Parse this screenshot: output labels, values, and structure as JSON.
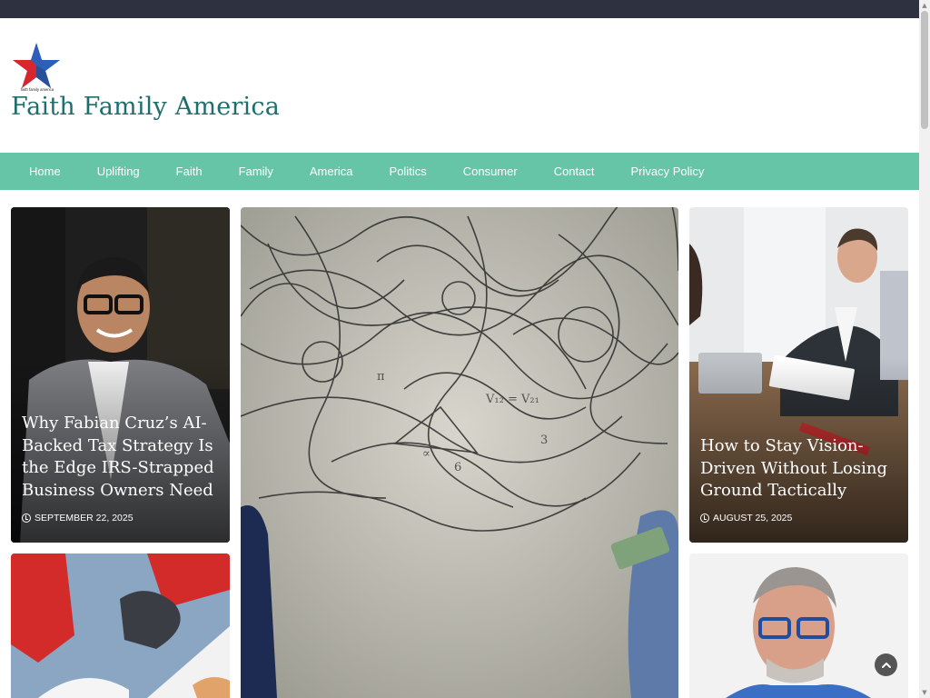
{
  "site": {
    "title": "Faith Family America",
    "logo_text": "faith family america",
    "colors": {
      "topbar": "#2e3240",
      "nav": "#66c5a6",
      "title": "#1e6e6e"
    }
  },
  "nav": {
    "items": [
      {
        "label": "Home"
      },
      {
        "label": "Uplifting"
      },
      {
        "label": "Faith"
      },
      {
        "label": "Family"
      },
      {
        "label": "America"
      },
      {
        "label": "Politics"
      },
      {
        "label": "Consumer"
      },
      {
        "label": "Contact"
      },
      {
        "label": "Privacy Policy"
      }
    ]
  },
  "posts": [
    {
      "title": "Why Fabian Cruz’s AI-Backed Tax Strategy Is the Edge IRS-Strapped Business Owners Need",
      "date": "SEPTEMBER 22, 2025",
      "image": "man-in-suit-glasses-photo"
    },
    {
      "title": "",
      "date": "",
      "image": "scribbled-equations-wall-photo"
    },
    {
      "title": "How to Stay Vision-Driven Without Losing Ground Tactically",
      "date": "AUGUST 25, 2025",
      "image": "business-meeting-photo"
    },
    {
      "title": "",
      "date": "",
      "image": "red-sneakers-papers-photo"
    },
    {
      "title": "",
      "date": "",
      "image": "man-blue-glasses-portrait-photo"
    }
  ],
  "icons": {
    "clock": "clock-icon",
    "back_to_top": "chevron-up-icon"
  }
}
